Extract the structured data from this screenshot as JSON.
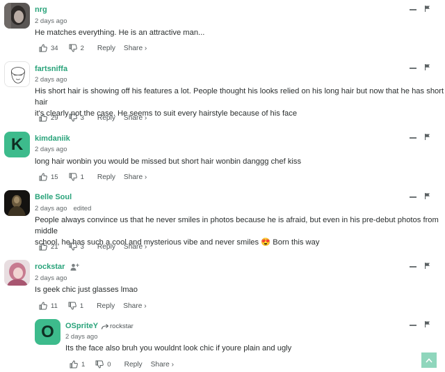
{
  "comments": [
    {
      "username": "nrg",
      "time": "2 days ago",
      "text": "He matches everything. He is an attractive man...",
      "likes": "34",
      "dislikes": "2",
      "reply": "Reply",
      "share": "Share ›"
    },
    {
      "username": "fartsniffa",
      "time": "2 days ago",
      "text_lines": [
        "His short hair is showing off his features a lot. People thought his looks relied on his long hair but now that he has short hair",
        "it's clearly not the case. He seems to suit every hairstyle because of his face"
      ],
      "likes": "29",
      "dislikes": "3",
      "reply": "Reply",
      "share": "Share ›"
    },
    {
      "username": "kimdaniik",
      "avatar_letter": "K",
      "time": "2 days ago",
      "text": "long hair wonbin you would be missed but short hair wonbin danggg chef kiss",
      "likes": "15",
      "dislikes": "1",
      "reply": "Reply",
      "share": "Share ›"
    },
    {
      "username": "Belle Soul",
      "time": "2 days ago",
      "edited": "edited",
      "text_lines": [
        "People always convince us that he never smiles in photos because he is afraid, but even in his pre-debut photos from middle",
        "school, he has such a cool and mysterious vibe and never smiles 😍 Born this way"
      ],
      "likes": "21",
      "dislikes": "3",
      "reply": "Reply",
      "share": "Share ›"
    },
    {
      "username": "rockstar",
      "time": "2 days ago",
      "text": "Is geek chic just glasses lmao",
      "likes": "11",
      "dislikes": "1",
      "reply": "Reply",
      "share": "Share ›"
    },
    {
      "username": "OSpriteY",
      "avatar_letter": "O",
      "reply_to": "rockstar",
      "time": "2 days ago",
      "text": "Its the face also bruh you wouldnt look chic if youre plain and ugly",
      "likes": "1",
      "dislikes": "0",
      "reply": "Reply",
      "share": "Share ›"
    }
  ],
  "colors": {
    "accent": "#29a37a",
    "avatar_bg": "#3dbb8c",
    "scroll_button": "#8fd6bc"
  },
  "icons": [
    "thumbs-up-icon",
    "thumbs-down-icon",
    "minus-icon",
    "flag-icon",
    "follow-user-icon",
    "reply-arrow-icon",
    "arrow-up-icon"
  ]
}
